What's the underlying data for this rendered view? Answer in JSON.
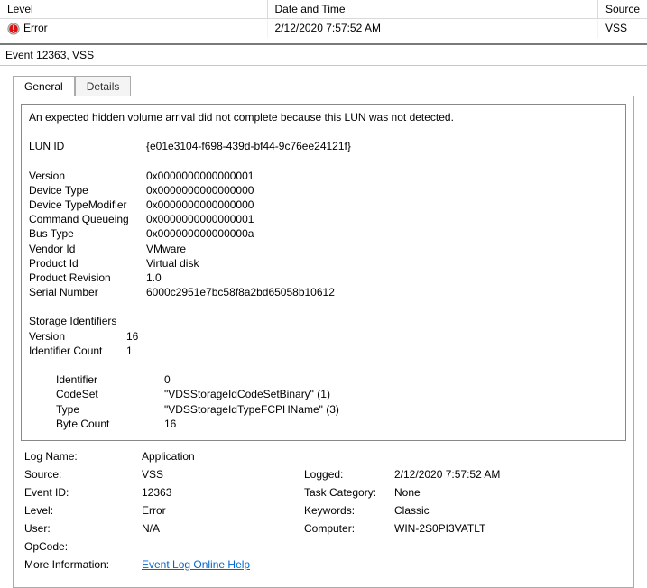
{
  "grid": {
    "headers": {
      "level": "Level",
      "datetime": "Date and Time",
      "source": "Source"
    },
    "row": {
      "level": "Error",
      "datetime": "2/12/2020 7:57:52 AM",
      "source": "VSS"
    }
  },
  "title": "Event 12363, VSS",
  "tabs": {
    "general": "General",
    "details": "Details"
  },
  "event": {
    "summary": "An expected hidden volume arrival did not complete because this LUN was not detected.",
    "labels": {
      "lun_id": "LUN ID",
      "version": "Version",
      "device_type": "Device Type",
      "device_type_modifier": "Device TypeModifier",
      "command_queueing": "Command Queueing",
      "bus_type": "Bus Type",
      "vendor_id": "Vendor Id",
      "product_id": "Product Id",
      "product_revision": "Product Revision",
      "serial_number": "Serial Number",
      "storage_identifiers": "Storage Identifiers",
      "si_version": "Version",
      "identifier_count": "Identifier Count",
      "identifier": "Identifier",
      "codeset": "CodeSet",
      "type": "Type",
      "byte_count": "Byte Count"
    },
    "lun_id": "{e01e3104-f698-439d-bf44-9c76ee24121f}",
    "version": "0x0000000000000001",
    "device_type": "0x0000000000000000",
    "device_type_modifier": "0x0000000000000000",
    "command_queueing": "0x0000000000000001",
    "bus_type": "0x000000000000000a",
    "vendor_id": "VMware",
    "product_id": "Virtual disk",
    "product_revision": "1.0",
    "serial_number": "6000c2951e7bc58f8a2bd65058b10612",
    "si_version": "16",
    "identifier_count": "1",
    "identifier": "0",
    "codeset": "\"VDSStorageIdCodeSetBinary\" (1)",
    "type": "\"VDSStorageIdTypeFCPHName\" (3)",
    "byte_count": "16"
  },
  "meta": {
    "labels": {
      "log_name": "Log Name:",
      "source": "Source:",
      "logged": "Logged:",
      "event_id": "Event ID:",
      "task_category": "Task Category:",
      "level": "Level:",
      "keywords": "Keywords:",
      "user": "User:",
      "computer": "Computer:",
      "opcode": "OpCode:",
      "more_info": "More Information:"
    },
    "log_name": "Application",
    "source": "VSS",
    "logged": "2/12/2020 7:57:52 AM",
    "event_id": "12363",
    "task_category": "None",
    "level": "Error",
    "keywords": "Classic",
    "user": "N/A",
    "computer": "WIN-2S0PI3VATLT",
    "opcode": "",
    "more_info_link": "Event Log Online Help"
  }
}
